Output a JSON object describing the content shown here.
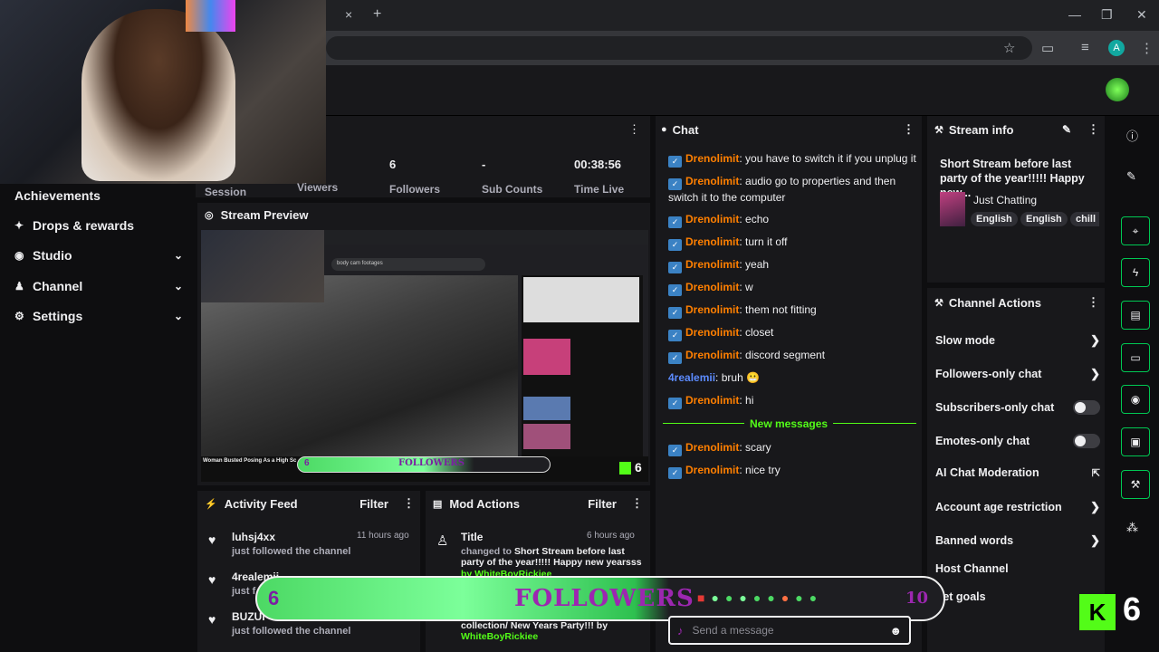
{
  "browser": {
    "tab_close": "×",
    "tab_new": "+",
    "window_minimize": "—",
    "window_restore": "❐",
    "window_close": "✕",
    "profile_initial": "A"
  },
  "sidebar": {
    "items": [
      {
        "label": "Achievements",
        "icon": "trophy-icon",
        "glyph": "",
        "chevron": ""
      },
      {
        "label": "Drops & rewards",
        "icon": "gift-icon",
        "glyph": "✦",
        "chevron": ""
      },
      {
        "label": "Studio",
        "icon": "camera-icon",
        "glyph": "◉",
        "chevron": "⌄"
      },
      {
        "label": "Channel",
        "icon": "person-icon",
        "glyph": "♟",
        "chevron": "⌄"
      },
      {
        "label": "Settings",
        "icon": "gear-icon",
        "glyph": "⚙",
        "chevron": "⌄"
      }
    ]
  },
  "stats": [
    {
      "value": "",
      "label": "Session"
    },
    {
      "value": "",
      "label": "Viewers"
    },
    {
      "value": "6",
      "label": "Followers"
    },
    {
      "value": "-",
      "label": "Sub Counts"
    },
    {
      "value": "00:38:56",
      "label": "Time Live"
    }
  ],
  "preview": {
    "title": "Stream Preview",
    "search_text": "body cam footages",
    "video_title": "Woman Busted Posing As a High Sc",
    "overlay_small_count": "6",
    "overlay_small_label": "FOLLOWERS",
    "kick_small_num": "6"
  },
  "chat": {
    "title": "Chat",
    "messages": [
      {
        "user": "Drenolimit",
        "text": "you have to switch it if you unplug it"
      },
      {
        "user": "Drenolimit",
        "text": "audio go to properties and then switch it to the computer"
      },
      {
        "user": "Drenolimit",
        "text": "echo"
      },
      {
        "user": "Drenolimit",
        "text": "turn it off"
      },
      {
        "user": "Drenolimit",
        "text": "yeah"
      },
      {
        "user": "Drenolimit",
        "text": "w"
      },
      {
        "user": "Drenolimit",
        "text": "them not fitting"
      },
      {
        "user": "Drenolimit",
        "text": "closet"
      },
      {
        "user": "Drenolimit",
        "text": "discord segment"
      },
      {
        "user": "4realemii",
        "text": "bruh 😬"
      },
      {
        "user": "Drenolimit",
        "text": "hi"
      }
    ],
    "new_messages_label": "New messages",
    "new_messages": [
      {
        "user": "Drenolimit",
        "text": "scary"
      },
      {
        "user": "Drenolimit",
        "text": "nice try"
      }
    ],
    "input_placeholder": "Send a message"
  },
  "stream_info": {
    "title": "Stream info",
    "stream_title": "Short Stream before last party of the year!!!!! Happy new...",
    "category": "Just Chatting",
    "tags": [
      "English",
      "English",
      "chill"
    ]
  },
  "channel_actions": {
    "title": "Channel Actions",
    "items": [
      {
        "label": "Slow mode",
        "control": "arrow"
      },
      {
        "label": "Followers-only chat",
        "control": "arrow"
      },
      {
        "label": "Subscribers-only chat",
        "control": "toggle"
      },
      {
        "label": "Emotes-only chat",
        "control": "toggle"
      },
      {
        "label": "AI Chat Moderation",
        "control": "external"
      },
      {
        "label": "Account age restriction",
        "control": "arrow"
      },
      {
        "label": "Banned words",
        "control": "arrow"
      },
      {
        "label": "Host Channel",
        "control": "none"
      },
      {
        "label": "Set goals",
        "control": "arrow"
      }
    ]
  },
  "activity_feed": {
    "title": "Activity Feed",
    "filter": "Filter",
    "items": [
      {
        "name": "luhsj4xx",
        "sub": "just followed the channel",
        "time": "11 hours ago"
      },
      {
        "name": "4realemii",
        "sub": "just f",
        "time": ""
      },
      {
        "name": "BUZUI",
        "sub": "just followed the channel",
        "time": ""
      }
    ]
  },
  "mod_actions": {
    "title": "Mod Actions",
    "filter": "Filter",
    "entry": {
      "title": "Title",
      "time": "6 hours ago",
      "changed_to": "changed to",
      "value": "Short Stream before last party of the year!!!!! Happy new yearsss",
      "by_partial": "by WhiteBoyRickiee",
      "tail": "collection/ New Years Party!!! by",
      "tail_user": "WhiteBoyRickiee"
    }
  },
  "overlay": {
    "count": "6",
    "label": "FOLLOWERS",
    "right_partial": "10",
    "kick_letter": "K",
    "kick_num": "6"
  },
  "colors": {
    "accent_green": "#53fc18",
    "chat_user": "#ff7f00",
    "panel": "#18181b",
    "background": "#0e0e10"
  }
}
